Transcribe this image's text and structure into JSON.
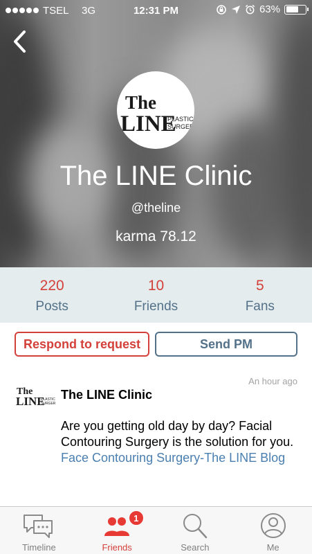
{
  "status_bar": {
    "carrier": "TSEL",
    "network": "3G",
    "time": "12:31 PM",
    "battery_percent": "63%",
    "battery_level": 0.63
  },
  "profile": {
    "name": "The LINE Clinic",
    "handle": "@theline",
    "karma": "karma 78.12",
    "logo": {
      "line1": "The",
      "line2": "LINE",
      "tag1": "PLASTIC",
      "tag2": "SURGERY"
    }
  },
  "stats": [
    {
      "count": "220",
      "label": "Posts"
    },
    {
      "count": "10",
      "label": "Friends"
    },
    {
      "count": "5",
      "label": "Fans"
    }
  ],
  "actions": {
    "respond_label": "Respond to request",
    "pm_label": "Send PM"
  },
  "post": {
    "time": "An hour ago",
    "author": "The LINE Clinic",
    "text": "Are you getting old day by day? Facial Contouring Surgery is the solution for you. ",
    "link": "Face Contouring Surgery-The LINE Blog"
  },
  "tabs": [
    {
      "label": "Timeline",
      "icon": "chat-bubbles-icon",
      "active": false
    },
    {
      "label": "Friends",
      "icon": "people-icon",
      "active": true,
      "badge": "1"
    },
    {
      "label": "Search",
      "icon": "search-icon",
      "active": false
    },
    {
      "label": "Me",
      "icon": "user-icon",
      "active": false
    }
  ],
  "colors": {
    "accent_red": "#d4403a",
    "accent_blue": "#537189",
    "link_blue": "#4a7fb0",
    "stats_background": "#e4ecee"
  }
}
